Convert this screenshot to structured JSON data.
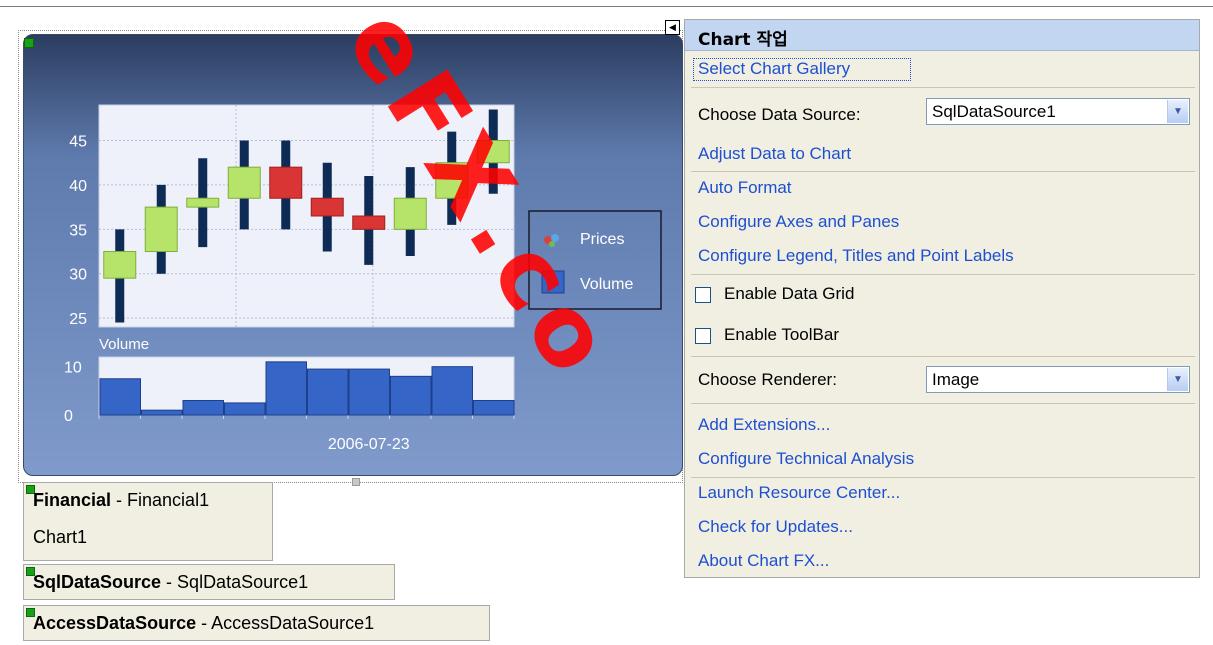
{
  "panel": {
    "title": "Chart 작업",
    "select_chart_gallery": "Select Chart Gallery",
    "choose_data_source_label": "Choose Data Source:",
    "data_source_value": "SqlDataSource1",
    "adjust_data": "Adjust Data to Chart",
    "auto_format": "Auto Format",
    "configure_axes": "Configure Axes and Panes",
    "configure_legend": "Configure Legend, Titles and Point Labels",
    "enable_data_grid": "Enable Data Grid",
    "enable_toolbar": "Enable ToolBar",
    "choose_renderer_label": "Choose Renderer:",
    "renderer_value": "Image",
    "add_extensions": "Add Extensions...",
    "configure_technical": "Configure Technical Analysis",
    "launch_resource": "Launch Resource Center...",
    "check_updates": "Check for Updates...",
    "about": "About Chart FX...",
    "toggle_glyph": "◀"
  },
  "tags": {
    "financial": {
      "type": "Financial",
      "sep": " - ",
      "id": "Financial1",
      "sub": "Chart1"
    },
    "sql": {
      "type": "SqlDataSource",
      "sep": " - ",
      "id": "SqlDataSource1"
    },
    "access": {
      "type": "AccessDataSource",
      "sep": " - ",
      "id": "AccessDataSource1"
    }
  },
  "watermark": "eFX.co",
  "chart_data": {
    "type": "candlestick",
    "x_label": "2006-07-23",
    "pane_title": "Volume",
    "legend": [
      "Prices",
      "Volume"
    ],
    "colors": {
      "up": "#b6e46b",
      "down": "#d93535",
      "wick": "#0d2b55",
      "volume": "#3566c7"
    },
    "price_ylim": [
      24,
      49
    ],
    "price_ticks": [
      25,
      30,
      35,
      40,
      45
    ],
    "volume_ylim": [
      0,
      12
    ],
    "volume_ticks": [
      0,
      10
    ],
    "candles": [
      {
        "open": 29.5,
        "close": 32.5,
        "low": 24.5,
        "high": 35.0
      },
      {
        "open": 32.5,
        "close": 37.5,
        "low": 30.0,
        "high": 40.0
      },
      {
        "open": 37.5,
        "close": 38.5,
        "low": 33.0,
        "high": 43.0
      },
      {
        "open": 38.5,
        "close": 42.0,
        "low": 35.0,
        "high": 45.0
      },
      {
        "open": 42.0,
        "close": 38.5,
        "low": 35.0,
        "high": 45.0
      },
      {
        "open": 38.5,
        "close": 36.5,
        "low": 32.5,
        "high": 42.5
      },
      {
        "open": 36.5,
        "close": 35.0,
        "low": 31.0,
        "high": 41.0
      },
      {
        "open": 35.0,
        "close": 38.5,
        "low": 32.0,
        "high": 42.0
      },
      {
        "open": 38.5,
        "close": 42.5,
        "low": 35.5,
        "high": 46.0
      },
      {
        "open": 42.5,
        "close": 45.0,
        "low": 39.0,
        "high": 48.5
      }
    ],
    "volume": [
      7.5,
      1,
      3,
      2.5,
      11,
      9.5,
      9.5,
      8,
      10,
      3
    ]
  }
}
